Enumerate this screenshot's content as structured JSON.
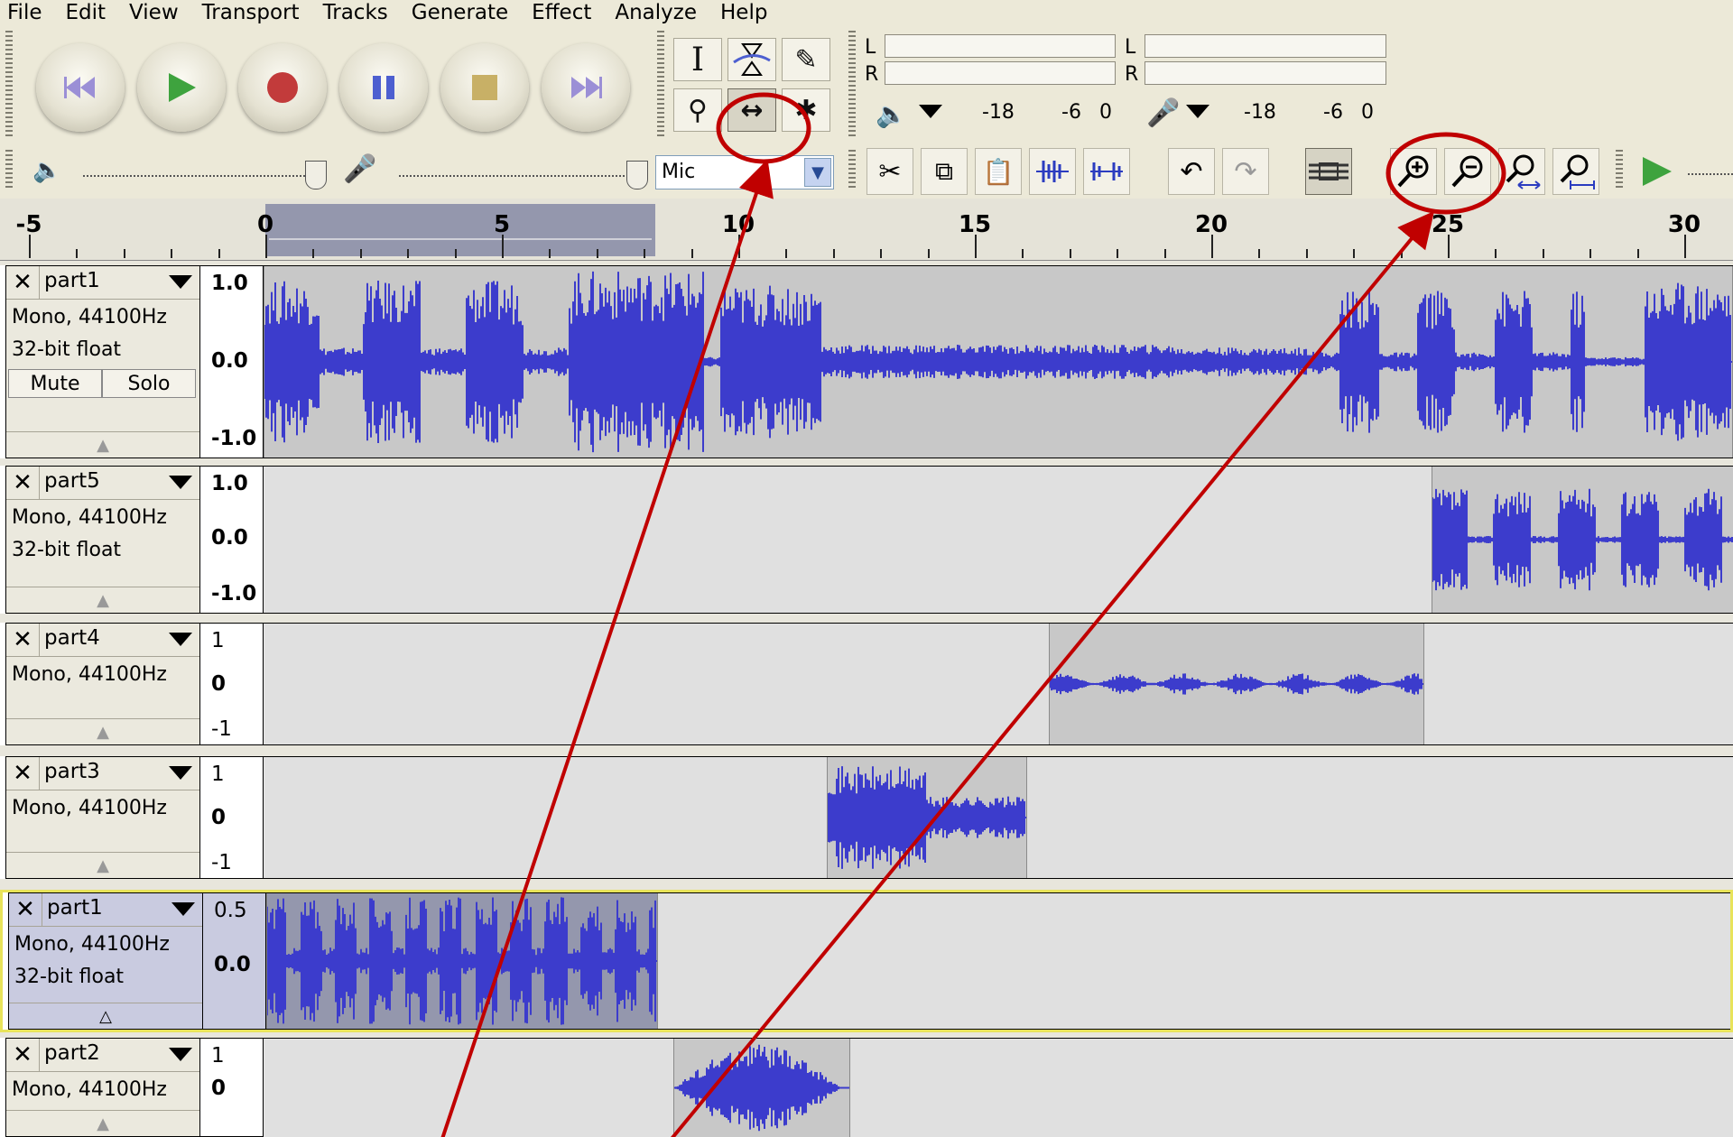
{
  "menu": [
    "File",
    "Edit",
    "View",
    "Transport",
    "Tracks",
    "Generate",
    "Effect",
    "Analyze",
    "Help"
  ],
  "transport": {
    "buttons": [
      {
        "name": "skip-start",
        "icon": "skip-to-start-icon",
        "color": "#9b8fd6"
      },
      {
        "name": "play",
        "icon": "play-icon",
        "color": "#3ea33e"
      },
      {
        "name": "record",
        "icon": "record-icon",
        "color": "#c23b3b"
      },
      {
        "name": "pause",
        "icon": "pause-icon",
        "color": "#4d5fd0"
      },
      {
        "name": "stop",
        "icon": "stop-icon",
        "color": "#c8b066"
      },
      {
        "name": "skip-end",
        "icon": "skip-to-end-icon",
        "color": "#9b8fd6"
      }
    ]
  },
  "meters": {
    "playback": {
      "left": "L",
      "right": "R",
      "tick_a": "-18",
      "tick_b": "-6",
      "tick_c": "0"
    },
    "record": {
      "left": "L",
      "right": "R",
      "tick_a": "-18",
      "tick_b": "-6",
      "tick_c": "0"
    }
  },
  "mixer": {
    "input_source": "Mic"
  },
  "ruler": {
    "labels": [
      "-5",
      "0",
      "5",
      "10",
      "15",
      "20",
      "25",
      "30"
    ]
  },
  "accent_wave": "#3c3ccc",
  "annotation_color": "#c00000",
  "tracks": [
    {
      "name": "part1",
      "info1": "Mono, 44100Hz",
      "info2": "32-bit float",
      "mute": "Mute",
      "solo": "Solo",
      "scale_top": "1.0",
      "scale_mid": "0.0",
      "scale_bot": "-1.0"
    },
    {
      "name": "part5",
      "info1": "Mono, 44100Hz",
      "info2": "32-bit float",
      "scale_top": "1.0",
      "scale_mid": "0.0",
      "scale_bot": "-1.0"
    },
    {
      "name": "part4",
      "info1": "Mono, 44100Hz",
      "scale_top": "1",
      "scale_mid": "0",
      "scale_bot": "-1"
    },
    {
      "name": "part3",
      "info1": "Mono, 44100Hz",
      "scale_top": "1",
      "scale_mid": "0",
      "scale_bot": "-1"
    },
    {
      "name": "part1",
      "info1": "Mono, 44100Hz",
      "info2": "32-bit float",
      "scale_top": "0.5",
      "scale_mid": "0.0"
    },
    {
      "name": "part2",
      "info1": "Mono, 44100Hz",
      "scale_top": "1",
      "scale_mid": "0"
    }
  ]
}
